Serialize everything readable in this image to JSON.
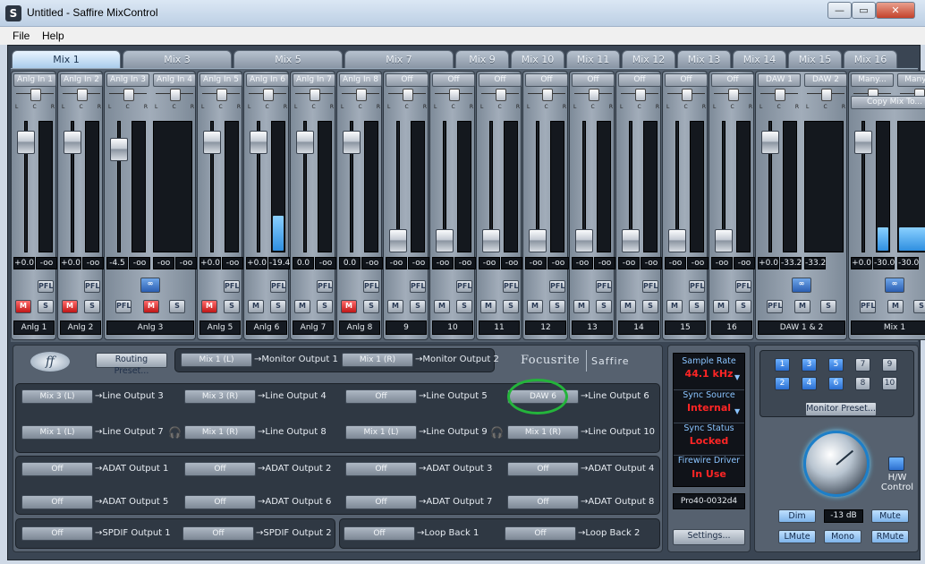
{
  "window": {
    "title": "Untitled - Saffire MixControl",
    "icon": "S",
    "min": "—",
    "max": "▭",
    "close": "✕"
  },
  "menu": [
    {
      "label": "File"
    },
    {
      "label": "Help"
    }
  ],
  "tabs": [
    {
      "label": "Mix 1",
      "active": true,
      "w": 124
    },
    {
      "label": "Mix 3",
      "w": 124
    },
    {
      "label": "Mix 5",
      "w": 124
    },
    {
      "label": "Mix 7",
      "w": 124
    },
    {
      "label": "Mix 9",
      "w": 62
    },
    {
      "label": "Mix 10",
      "w": 62
    },
    {
      "label": "Mix 11",
      "w": 62
    },
    {
      "label": "Mix 12",
      "w": 62
    },
    {
      "label": "Mix 13",
      "w": 62
    },
    {
      "label": "Mix 14",
      "w": 62
    },
    {
      "label": "Mix 15",
      "w": 62
    },
    {
      "label": "Mix 16",
      "w": 62
    }
  ],
  "pan_labels": {
    "l": "L",
    "c": "C",
    "r": "R"
  },
  "groups": [
    {
      "name": "Anlg 1",
      "channels": [
        {
          "src": "Anlg In 1",
          "fader": 0.0,
          "meter": 0,
          "l": "+0.0",
          "r": "-oo",
          "mute": true
        }
      ]
    },
    {
      "name": "Anlg 2",
      "channels": [
        {
          "src": "Anlg In 2",
          "fader": 0.0,
          "meter": 0,
          "l": "+0.0",
          "r": "-oo",
          "mute": true
        }
      ]
    },
    {
      "name": "Anlg 3",
      "channels": [
        {
          "src": "Anlg In 3",
          "fader": -4.5,
          "meter": 0,
          "l": "-4.5",
          "r": "-oo",
          "mute": true
        },
        {
          "src": "Anlg In 4",
          "fader": -60,
          "meter": 0,
          "l": "-oo",
          "r": "-oo",
          "mute": false,
          "hidefader": true
        }
      ],
      "linked": true
    },
    {
      "name": "Anlg 5",
      "channels": [
        {
          "src": "Anlg In 5",
          "fader": 0.0,
          "meter": 0,
          "l": "+0.0",
          "r": "-oo",
          "mute": true
        }
      ]
    },
    {
      "name": "Anlg 6",
      "channels": [
        {
          "src": "Anlg In 6",
          "fader": 0.0,
          "meter": 0.27,
          "l": "+0.0",
          "r": "-19.4",
          "mute": false
        }
      ]
    },
    {
      "name": "Anlg 7",
      "channels": [
        {
          "src": "Anlg In 7",
          "fader": 0.0,
          "meter": 0,
          "l": "0.0",
          "r": "-oo",
          "mute": false
        }
      ]
    },
    {
      "name": "Anlg 8",
      "channels": [
        {
          "src": "Anlg In 8",
          "fader": 0.0,
          "meter": 0,
          "l": "0.0",
          "r": "-oo",
          "mute": true
        }
      ]
    },
    {
      "name": "9",
      "channels": [
        {
          "src": "Off",
          "fader": -60,
          "meter": 0,
          "l": "-oo",
          "r": "-oo",
          "mute": false
        }
      ]
    },
    {
      "name": "10",
      "channels": [
        {
          "src": "Off",
          "fader": -60,
          "meter": 0,
          "l": "-oo",
          "r": "-oo",
          "mute": false
        }
      ]
    },
    {
      "name": "11",
      "channels": [
        {
          "src": "Off",
          "fader": -60,
          "meter": 0,
          "l": "-oo",
          "r": "-oo",
          "mute": false
        }
      ]
    },
    {
      "name": "12",
      "channels": [
        {
          "src": "Off",
          "fader": -60,
          "meter": 0,
          "l": "-oo",
          "r": "-oo",
          "mute": false
        }
      ]
    },
    {
      "name": "13",
      "channels": [
        {
          "src": "Off",
          "fader": -60,
          "meter": 0,
          "l": "-oo",
          "r": "-oo",
          "mute": false
        }
      ]
    },
    {
      "name": "14",
      "channels": [
        {
          "src": "Off",
          "fader": -60,
          "meter": 0,
          "l": "-oo",
          "r": "-oo",
          "mute": false
        }
      ]
    },
    {
      "name": "15",
      "channels": [
        {
          "src": "Off",
          "fader": -60,
          "meter": 0,
          "l": "-oo",
          "r": "-oo",
          "mute": false
        }
      ]
    },
    {
      "name": "16",
      "channels": [
        {
          "src": "Off",
          "fader": -60,
          "meter": 0,
          "l": "-oo",
          "r": "-oo",
          "mute": false
        }
      ]
    },
    {
      "name": "DAW 1 & 2",
      "channels": [
        {
          "src": "DAW 1",
          "fader": 0.0,
          "meter": 0,
          "l": "+0.0",
          "r": "-33.2",
          "mute": false
        },
        {
          "src": "DAW 2",
          "fader": -60,
          "meter": 0,
          "l": "-33.2",
          "r": "",
          "mute": false,
          "hidefader": true
        }
      ],
      "linked": true,
      "stereo": true
    },
    {
      "name": "Mix 1",
      "channels": [
        {
          "src": "Many...",
          "fader": 0.0,
          "meter": 0.18,
          "l": "+0.0",
          "r": "-30.0",
          "mute": false
        },
        {
          "src": "Many...",
          "fader": -60,
          "meter": 0.18,
          "l": "-30.0",
          "r": "",
          "mute": false,
          "hidefader": true
        }
      ],
      "linked": true,
      "master": true
    }
  ],
  "buttons": {
    "pfl": "PFL",
    "mute": "M",
    "solo": "S",
    "copy_mix": "Copy Mix To..."
  },
  "routing": {
    "preset_label": "Routing Preset...",
    "monitor": [
      {
        "src": "Mix 1 (L)",
        "dst": "Monitor Output 1"
      },
      {
        "src": "Mix 1 (R)",
        "dst": "Monitor Output 2"
      }
    ],
    "line": [
      {
        "src": "Mix 3 (L)",
        "dst": "Line Output 3"
      },
      {
        "src": "Mix 3 (R)",
        "dst": "Line Output 4"
      },
      {
        "src": "Off",
        "dst": "Line Output 5"
      },
      {
        "src": "DAW 6",
        "dst": "Line Output 6"
      },
      {
        "src": "Mix 1 (L)",
        "dst": "Line Output 7"
      },
      {
        "src": "Mix 1 (R)",
        "dst": "Line Output 8"
      },
      {
        "src": "Mix 1 (L)",
        "dst": "Line Output 9"
      },
      {
        "src": "Mix 1 (R)",
        "dst": "Line Output 10"
      }
    ],
    "adat": [
      {
        "src": "Off",
        "dst": "ADAT Output 1"
      },
      {
        "src": "Off",
        "dst": "ADAT Output 2"
      },
      {
        "src": "Off",
        "dst": "ADAT Output 3"
      },
      {
        "src": "Off",
        "dst": "ADAT Output 4"
      },
      {
        "src": "Off",
        "dst": "ADAT Output 5"
      },
      {
        "src": "Off",
        "dst": "ADAT Output 6"
      },
      {
        "src": "Off",
        "dst": "ADAT Output 7"
      },
      {
        "src": "Off",
        "dst": "ADAT Output 8"
      }
    ],
    "spdif": [
      {
        "src": "Off",
        "dst": "SPDIF Output 1"
      },
      {
        "src": "Off",
        "dst": "SPDIF Output 2"
      }
    ],
    "loop": [
      {
        "src": "Off",
        "dst": "Loop Back 1"
      },
      {
        "src": "Off",
        "dst": "Loop Back 2"
      }
    ],
    "headphone_icon": "headphones-icon"
  },
  "brand": {
    "name": "Focusrite",
    "product": "Saffire",
    "logo": "ff"
  },
  "status": {
    "sample_rate_label": "Sample Rate",
    "sample_rate": "44.1 kHz",
    "sync_source_label": "Sync Source",
    "sync_source": "Internal",
    "sync_status_label": "Sync Status",
    "sync_status": "Locked",
    "driver_label": "Firewire Driver",
    "driver": "In Use",
    "device_id": "Pro40-0032d4",
    "settings_label": "Settings..."
  },
  "monitor": {
    "preset_buttons": [
      {
        "label": "1",
        "on": true
      },
      {
        "label": "3",
        "on": true
      },
      {
        "label": "5",
        "on": true
      },
      {
        "label": "7",
        "on": false
      },
      {
        "label": "9",
        "on": false
      },
      {
        "label": "2",
        "on": true
      },
      {
        "label": "4",
        "on": true
      },
      {
        "label": "6",
        "on": true
      },
      {
        "label": "8",
        "on": false
      },
      {
        "label": "10",
        "on": false
      }
    ],
    "preset_label": "Monitor Preset...",
    "hw_label": "H/W\nControl",
    "dim": "Dim",
    "level": "-13 dB",
    "mute": "Mute",
    "lmute": "LMute",
    "mono": "Mono",
    "rmute": "RMute"
  },
  "colors": {
    "accent": "#2b6fd1",
    "mute_on": "#c01717",
    "status_value": "#ff2525",
    "status_label": "#8ac4ff",
    "annotation": "#24b43b"
  }
}
